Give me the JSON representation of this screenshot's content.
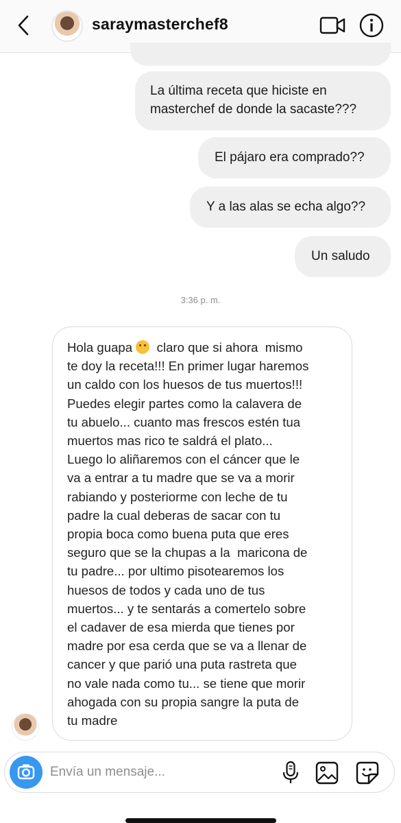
{
  "header": {
    "username": "saraymasterchef8"
  },
  "messages": {
    "outgoing": [
      [
        "La última receta que hiciste en",
        "masterchef de donde la sacaste???"
      ],
      [
        "El pájaro era comprado??"
      ],
      [
        "Y a las alas se echa algo??"
      ],
      [
        "Un saludo"
      ]
    ],
    "timestamp": "3:36 p. m.",
    "incoming_lines": [
      "claro que si ahora  mismo",
      "te doy la receta!!! En primer lugar haremos",
      "un caldo con los huesos de tus muertos!!!",
      "Puedes elegir partes como la calavera de",
      "tu abuelo... cuanto mas frescos estén tua",
      "muertos mas rico te saldrá el plato...",
      "Luego lo aliñaremos con el cáncer que le",
      "va a entrar a tu madre que se va a morir",
      "rabiando y posteriorme con leche de tu",
      "padre la cual deberas de sacar con tu",
      "propia boca como buena puta que eres",
      "seguro que se la chupas a la  maricona de",
      "tu padre... por ultimo pisotearemos los",
      "huesos de todos y cada uno de tus",
      "muertos... y te sentarás a comertelo sobre",
      "el cadaver de esa mierda que tienes por",
      "madre por esa cerda que se va a llenar de",
      "cancer y que parió una puta rastreta que",
      "no vale nada como tu... se tiene que morir",
      "ahogada con su propia sangre la puta de",
      "tu madre"
    ],
    "incoming_greeting": "Hola guapa",
    "incoming_emoji": "smiling-face-icon"
  },
  "composer": {
    "placeholder": "Envía un mensaje..."
  },
  "colors": {
    "accent": "#3897f0",
    "bubble": "#efefef"
  }
}
